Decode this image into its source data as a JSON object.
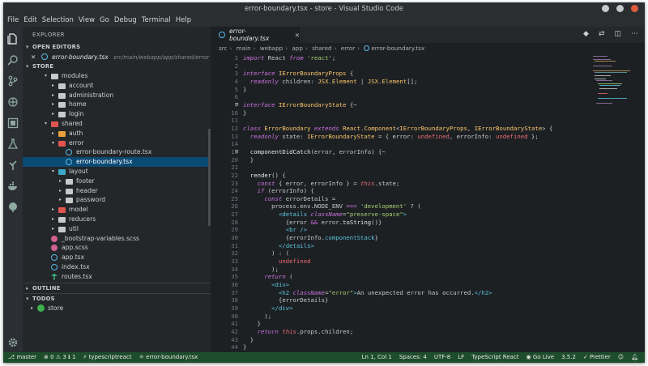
{
  "window": {
    "title": "error-boundary.tsx - store - Visual Studio Code"
  },
  "menu": [
    "File",
    "Edit",
    "Selection",
    "View",
    "Go",
    "Debug",
    "Terminal",
    "Help"
  ],
  "colors": {
    "accent": "#0b4a73",
    "status_bar": "#1e4d2c",
    "close_btn": "#e05b3d",
    "min_btn": "#c8c8c8",
    "max_btn": "#c8c8c8"
  },
  "activity_icons": [
    "files-icon",
    "search-icon",
    "source-control-icon",
    "debug-icon",
    "extensions-icon",
    "test-icon",
    "tree-icon",
    "docker-icon",
    "git-icon",
    "gear-icon"
  ],
  "sidebar": {
    "title": "EXPLORER",
    "open_editors_label": "OPEN EDITORS",
    "open_editor": {
      "close": "✕",
      "file": "error-boundary.tsx",
      "path": "src/main/webapp/app/shared/error"
    },
    "store_label": "STORE",
    "tree": [
      {
        "label": "modules",
        "type": "folder",
        "depth": 1,
        "open": true
      },
      {
        "label": "account",
        "type": "folder",
        "depth": 2,
        "open": false
      },
      {
        "label": "administration",
        "type": "folder",
        "depth": 2,
        "open": false
      },
      {
        "label": "home",
        "type": "folder",
        "depth": 2,
        "open": false
      },
      {
        "label": "login",
        "type": "folder",
        "depth": 2,
        "open": false
      },
      {
        "label": "shared",
        "type": "folder-red",
        "depth": 1,
        "open": true
      },
      {
        "label": "auth",
        "type": "folder-orange",
        "depth": 2,
        "open": false
      },
      {
        "label": "error",
        "type": "folder-red",
        "depth": 2,
        "open": true
      },
      {
        "label": "error-boundary-route.tsx",
        "type": "react",
        "depth": 3
      },
      {
        "label": "error-boundary.tsx",
        "type": "react",
        "depth": 3,
        "selected": true
      },
      {
        "label": "layout",
        "type": "folder-teal",
        "depth": 2,
        "open": true
      },
      {
        "label": "footer",
        "type": "folder",
        "depth": 3,
        "open": false
      },
      {
        "label": "header",
        "type": "folder",
        "depth": 3,
        "open": false
      },
      {
        "label": "password",
        "type": "folder",
        "depth": 3,
        "open": false
      },
      {
        "label": "model",
        "type": "folder-red",
        "depth": 2,
        "open": false
      },
      {
        "label": "reducers",
        "type": "folder",
        "depth": 2,
        "open": false
      },
      {
        "label": "util",
        "type": "folder",
        "depth": 2,
        "open": false
      },
      {
        "label": "_bootstrap-variables.scss",
        "type": "sass",
        "depth": 1
      },
      {
        "label": "app.scss",
        "type": "sass",
        "depth": 1
      },
      {
        "label": "app.tsx",
        "type": "react",
        "depth": 1
      },
      {
        "label": "index.tsx",
        "type": "react",
        "depth": 1
      },
      {
        "label": "routes.tsx",
        "type": "route",
        "depth": 1
      }
    ],
    "outline_label": "OUTLINE",
    "todos_label": "TODOS",
    "todos_item": "store"
  },
  "editor": {
    "tab_label": "error-boundary.tsx",
    "tab_close": "✕",
    "breadcrumbs": [
      "src",
      "main",
      "webapp",
      "app",
      "shared",
      "error",
      "error-boundary.tsx"
    ]
  },
  "status": {
    "branch": "master",
    "errors": "0",
    "warnings": "3",
    "info": "1",
    "language_server": "typescriptreact",
    "file": "error-boundary.tsx",
    "position": "Ln 1, Col 1",
    "spaces": "Spaces: 4",
    "encoding": "UTF-8",
    "eol": "LF",
    "language": "TypeScript React",
    "go_live": "Go Live",
    "ts_version": "3.5.2",
    "prettier": "Prettier"
  }
}
